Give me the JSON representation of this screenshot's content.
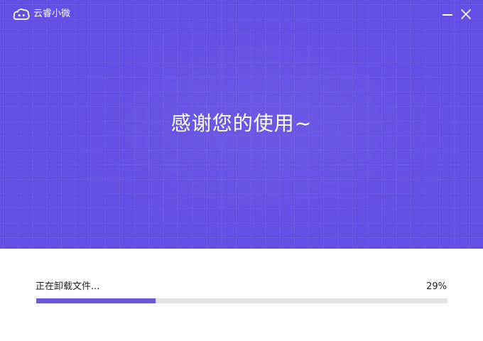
{
  "window": {
    "app_title": "云睿小微",
    "logo_icon": "app-logo-icon",
    "minimize_icon": "minimize-icon",
    "close_icon": "close-icon"
  },
  "hero": {
    "headline": "感谢您的使用~",
    "background_color": "#624fe4"
  },
  "progress": {
    "status": "正在卸载文件...",
    "percent_label": "29%",
    "value": 0.29,
    "fill_color": "#6b58d6",
    "track_color": "#e3e3e3"
  }
}
